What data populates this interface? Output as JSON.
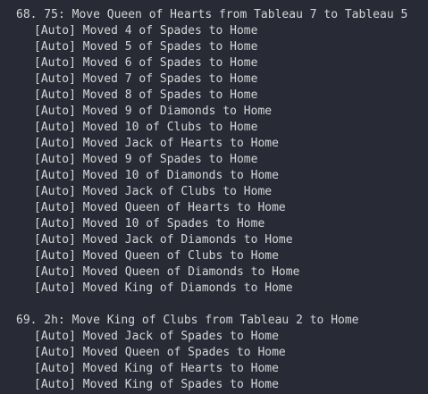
{
  "log": {
    "moves": [
      {
        "header": "68. 75: Move Queen of Hearts from Tableau 7 to Tableau 5",
        "auto_lines": [
          "[Auto] Moved 4 of Spades to Home",
          "[Auto] Moved 5 of Spades to Home",
          "[Auto] Moved 6 of Spades to Home",
          "[Auto] Moved 7 of Spades to Home",
          "[Auto] Moved 8 of Spades to Home",
          "[Auto] Moved 9 of Diamonds to Home",
          "[Auto] Moved 10 of Clubs to Home",
          "[Auto] Moved Jack of Hearts to Home",
          "[Auto] Moved 9 of Spades to Home",
          "[Auto] Moved 10 of Diamonds to Home",
          "[Auto] Moved Jack of Clubs to Home",
          "[Auto] Moved Queen of Hearts to Home",
          "[Auto] Moved 10 of Spades to Home",
          "[Auto] Moved Jack of Diamonds to Home",
          "[Auto] Moved Queen of Clubs to Home",
          "[Auto] Moved Queen of Diamonds to Home",
          "[Auto] Moved King of Diamonds to Home"
        ]
      },
      {
        "header": "69. 2h: Move King of Clubs from Tableau 2 to Home",
        "auto_lines": [
          "[Auto] Moved Jack of Spades to Home",
          "[Auto] Moved Queen of Spades to Home",
          "[Auto] Moved King of Hearts to Home",
          "[Auto] Moved King of Spades to Home"
        ]
      }
    ]
  }
}
